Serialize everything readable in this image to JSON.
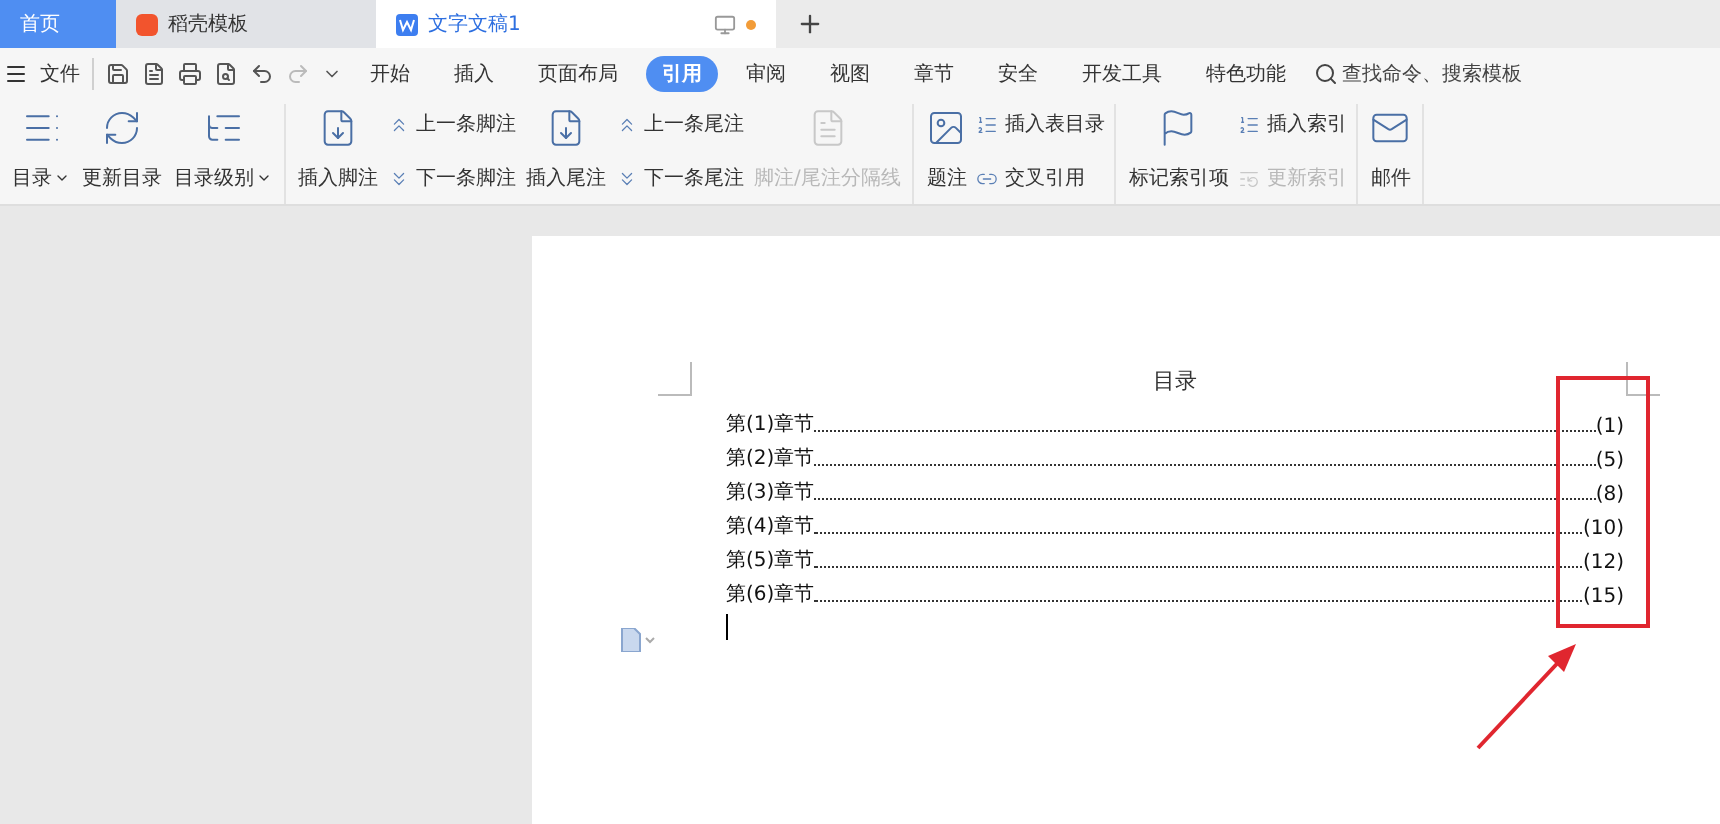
{
  "tabs": [
    {
      "label": "首页",
      "kind": "home",
      "selected": false
    },
    {
      "label": "稻壳模板",
      "kind": "app",
      "selected": false
    },
    {
      "label": "文字文稿1",
      "kind": "doc",
      "selected": true,
      "modified": true
    }
  ],
  "menu": {
    "file": "文件",
    "items": [
      {
        "label": "开始",
        "selected": false
      },
      {
        "label": "插入",
        "selected": false
      },
      {
        "label": "页面布局",
        "selected": false
      },
      {
        "label": "引用",
        "selected": true
      },
      {
        "label": "审阅",
        "selected": false
      },
      {
        "label": "视图",
        "selected": false
      },
      {
        "label": "章节",
        "selected": false
      },
      {
        "label": "安全",
        "selected": false
      },
      {
        "label": "开发工具",
        "selected": false
      },
      {
        "label": "特色功能",
        "selected": false
      }
    ],
    "search": {
      "placeholder": "查找命令、搜索模板"
    }
  },
  "ribbon": [
    {
      "columns": [
        {
          "kind": "large",
          "label": "目录",
          "dropdown": true,
          "disabled": false
        },
        {
          "kind": "large",
          "label": "更新目录",
          "dropdown": false,
          "disabled": false
        },
        {
          "kind": "large",
          "label": "目录级别",
          "dropdown": true,
          "disabled": false
        }
      ]
    },
    {
      "columns": [
        {
          "kind": "large",
          "label": "插入脚注",
          "dropdown": false,
          "disabled": false
        },
        {
          "kind": "small",
          "items": [
            {
              "label": "上一条脚注",
              "disabled": false
            },
            {
              "label": "下一条脚注",
              "disabled": false
            }
          ]
        },
        {
          "kind": "large",
          "label": "插入尾注",
          "dropdown": false,
          "disabled": false
        },
        {
          "kind": "small",
          "items": [
            {
              "label": "上一条尾注",
              "disabled": false
            },
            {
              "label": "下一条尾注",
              "disabled": false
            }
          ]
        },
        {
          "kind": "large",
          "label": "脚注/尾注分隔线",
          "dropdown": false,
          "disabled": true
        }
      ]
    },
    {
      "columns": [
        {
          "kind": "large",
          "label": "题注",
          "dropdown": false,
          "disabled": false
        },
        {
          "kind": "small",
          "items": [
            {
              "label": "插入表目录",
              "disabled": false
            },
            {
              "label": "交叉引用",
              "disabled": false
            }
          ]
        }
      ]
    },
    {
      "columns": [
        {
          "kind": "large",
          "label": "标记索引项",
          "dropdown": false,
          "disabled": false
        },
        {
          "kind": "small",
          "items": [
            {
              "label": "插入索引",
              "disabled": false
            },
            {
              "label": "更新索引",
              "disabled": true
            }
          ]
        }
      ]
    },
    {
      "columns": [
        {
          "kind": "large",
          "label": "邮件",
          "dropdown": false,
          "disabled": false
        }
      ]
    }
  ],
  "document": {
    "title": "目录",
    "entries": [
      {
        "title": "第(1)章节",
        "page": "(1)"
      },
      {
        "title": "第(2)章节",
        "page": "(5)"
      },
      {
        "title": "第(3)章节",
        "page": "(8)"
      },
      {
        "title": "第(4)章节",
        "page": "(10)"
      },
      {
        "title": "第(5)章节",
        "page": "(12)"
      },
      {
        "title": "第(6)章节",
        "page": "(15)"
      }
    ]
  }
}
